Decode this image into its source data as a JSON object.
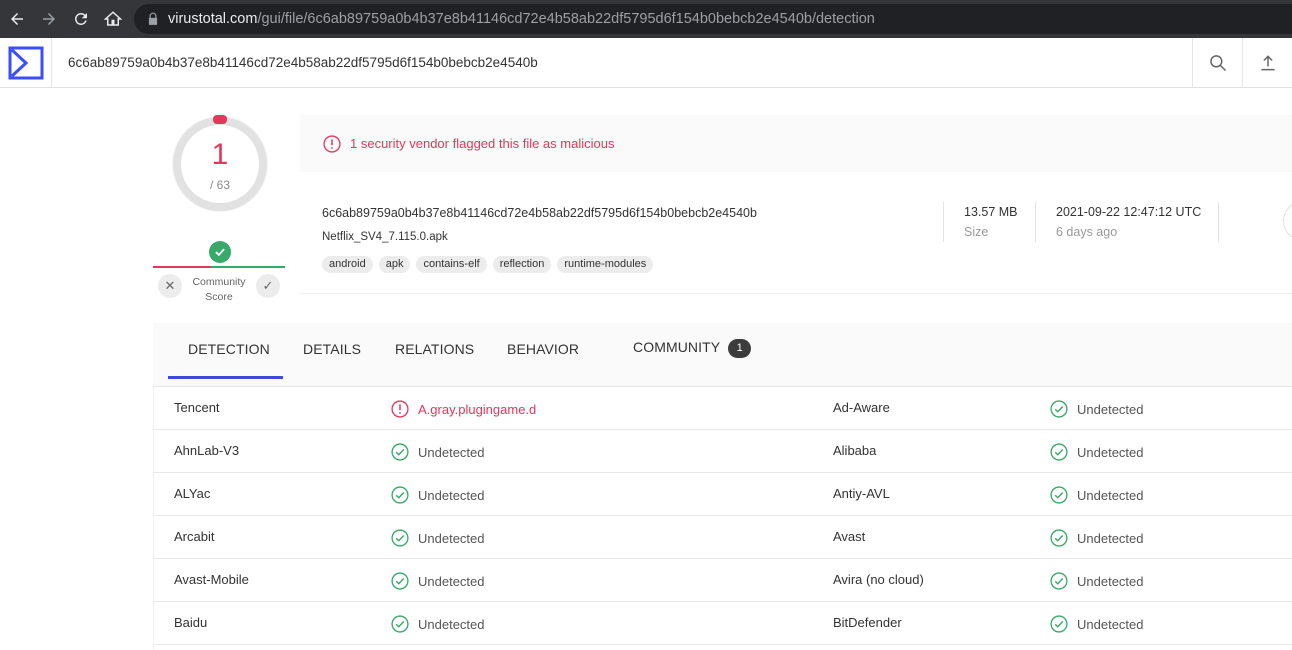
{
  "browser": {
    "url_host": "virustotal.com",
    "url_path": "/gui/file/6c6ab89759a0b4b37e8b41146cd72e4b58ab22df5795d6f154b0bebcb2e4540b/detection"
  },
  "header": {
    "search_value": "6c6ab89759a0b4b37e8b41146cd72e4b58ab22df5795d6f154b0bebcb2e4540b"
  },
  "score": {
    "detections": "1",
    "total": "/ 63",
    "community_label_line1": "Community",
    "community_label_line2": "Score"
  },
  "alert": {
    "text": "1 security vendor flagged this file as malicious"
  },
  "file": {
    "hash": "6c6ab89759a0b4b37e8b41146cd72e4b58ab22df5795d6f154b0bebcb2e4540b",
    "name": "Netflix_SV4_7.115.0.apk",
    "tags": [
      "android",
      "apk",
      "contains-elf",
      "reflection",
      "runtime-modules"
    ],
    "size_value": "13.57 MB",
    "size_label": "Size",
    "date_value": "2021-09-22 12:47:12 UTC",
    "date_label": "6 days ago"
  },
  "tabs": [
    {
      "label": "DETECTION"
    },
    {
      "label": "DETAILS"
    },
    {
      "label": "RELATIONS"
    },
    {
      "label": "BEHAVIOR"
    },
    {
      "label": "COMMUNITY",
      "badge": "1"
    }
  ],
  "detections": [
    {
      "left_vendor": "Tencent",
      "left_result": "A.gray.plugingame.d",
      "left_status": "malicious",
      "right_vendor": "Ad-Aware",
      "right_result": "Undetected",
      "right_status": "undetected"
    },
    {
      "left_vendor": "AhnLab-V3",
      "left_result": "Undetected",
      "left_status": "undetected",
      "right_vendor": "Alibaba",
      "right_result": "Undetected",
      "right_status": "undetected"
    },
    {
      "left_vendor": "ALYac",
      "left_result": "Undetected",
      "left_status": "undetected",
      "right_vendor": "Antiy-AVL",
      "right_result": "Undetected",
      "right_status": "undetected"
    },
    {
      "left_vendor": "Arcabit",
      "left_result": "Undetected",
      "left_status": "undetected",
      "right_vendor": "Avast",
      "right_result": "Undetected",
      "right_status": "undetected"
    },
    {
      "left_vendor": "Avast-Mobile",
      "left_result": "Undetected",
      "left_status": "undetected",
      "right_vendor": "Avira (no cloud)",
      "right_result": "Undetected",
      "right_status": "undetected"
    },
    {
      "left_vendor": "Baidu",
      "left_result": "Undetected",
      "left_status": "undetected",
      "right_vendor": "BitDefender",
      "right_result": "Undetected",
      "right_status": "undetected"
    }
  ],
  "colors": {
    "malicious": "#e5375b",
    "clean": "#37a969",
    "accent": "#3f4bd4"
  }
}
